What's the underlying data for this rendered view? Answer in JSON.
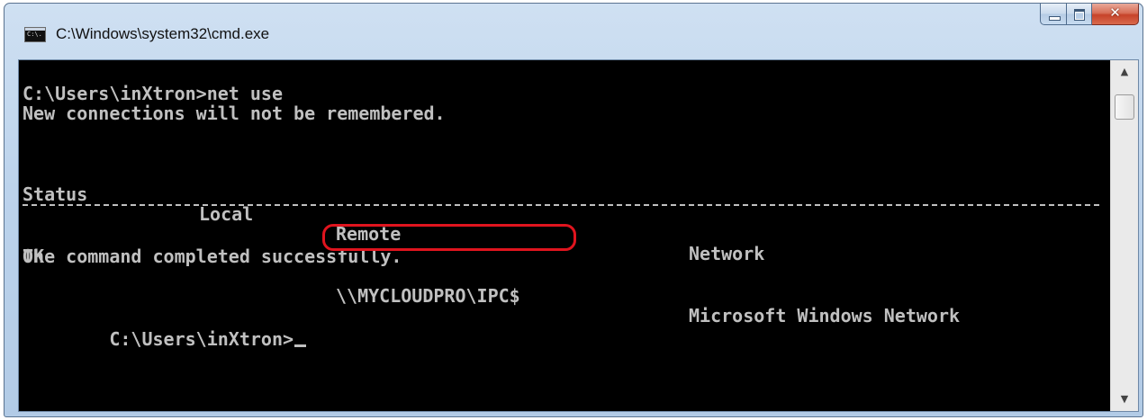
{
  "window": {
    "title": "C:\\Windows\\system32\\cmd.exe",
    "app_icon_text": "C:\\."
  },
  "console": {
    "prompt_command": "C:\\Users\\inXtron>net use",
    "notice": "New connections will not be remembered.",
    "headers": {
      "status": "Status",
      "local": "Local",
      "remote": "Remote",
      "network": "Network"
    },
    "connection": {
      "status": "OK",
      "local": "",
      "remote": "\\\\MYCLOUDPRO\\IPC$",
      "network": "Microsoft Windows Network"
    },
    "completed": "The command completed successfully.",
    "prompt": "C:\\Users\\inXtron>"
  },
  "colors": {
    "console_background": "#000000",
    "console_text": "#c0c0c0",
    "highlight_ring": "#e0141e",
    "close_button": "#c6432a"
  },
  "icons": {
    "app": "cmd-icon",
    "minimize": "minimize-icon",
    "maximize": "maximize-icon",
    "close": "close-icon",
    "scroll_up": "scroll-up-arrow-icon",
    "scroll_down": "scroll-down-arrow-icon"
  }
}
